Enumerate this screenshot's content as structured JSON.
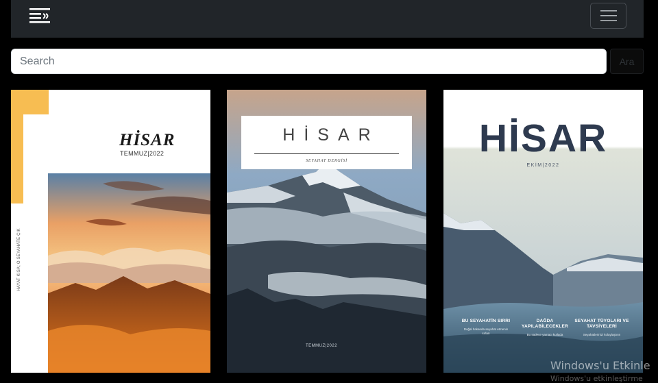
{
  "navbar": {
    "logo_icon": "book-lines-icon",
    "toggler_icon": "hamburger-icon"
  },
  "search": {
    "placeholder": "Search",
    "button_label": "Ara"
  },
  "magazines": [
    {
      "title": "HİSAR",
      "subtitle": "TEMMUZ|2022",
      "side_text": "HAYAT KISA; O SEYAHATE ÇIK",
      "accent_color": "#f7bd52"
    },
    {
      "title": "HİSAR",
      "tagline": "SEYAHAT DERGİSİ",
      "date": "TEMMUZ|2022"
    },
    {
      "title": "HİSAR",
      "subtitle": "EKİM|2022",
      "title_color": "#2e3a4f",
      "features": [
        {
          "title": "BU SEYAHATİN SIRRI",
          "desc": "Doğal hakanda seyahat etmenin sırları"
        },
        {
          "title": "DAĞDA YAPILABİLECEKLER",
          "desc": "Bu sadece yamacı kutlada"
        },
        {
          "title": "SEYAHAT TÜYOLARI VE TAVSİYELERİ",
          "desc": "Seyahatlerinizi kolaylaştırın"
        }
      ]
    }
  ],
  "watermark": {
    "line1": "Windows'u Etkinle",
    "line2": "Windows'u etkinleştirme"
  }
}
